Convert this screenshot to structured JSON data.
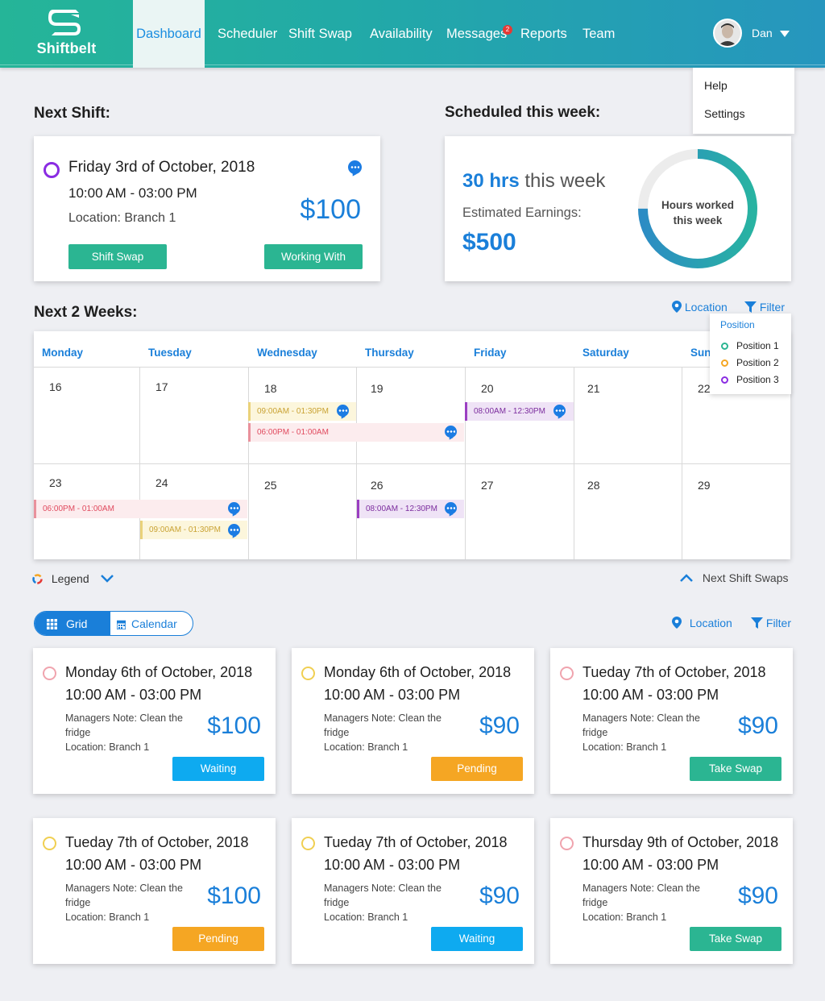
{
  "brand": {
    "name": "Shiftbelt"
  },
  "nav": {
    "items": [
      {
        "label": "Dashboard",
        "active": true
      },
      {
        "label": "Scheduler"
      },
      {
        "label": "Shift Swap"
      },
      {
        "label": "Availability"
      },
      {
        "label": "Messages",
        "badge": "2"
      },
      {
        "label": "Reports"
      },
      {
        "label": "Team"
      }
    ],
    "user": {
      "name": "Dan"
    },
    "user_menu": [
      "Help",
      "Settings"
    ]
  },
  "next_shift": {
    "title": "Next Shift:",
    "date": "Friday 3rd of October, 2018",
    "time": "10:00 AM - 03:00 PM",
    "location": "Location: Branch 1",
    "price": "$100",
    "buttons": {
      "swap": "Shift Swap",
      "working_with": "Working With"
    }
  },
  "scheduled": {
    "title": "Scheduled this week:",
    "hours": "30 hrs",
    "hours_suffix": "this week",
    "earnings_label": "Estimated Earnings:",
    "earnings": "$500",
    "donut_label_line1": "Hours worked",
    "donut_label_line2": "this week",
    "donut_fraction": 0.75
  },
  "calendar": {
    "title": "Next 2 Weeks:",
    "location_label": "Location",
    "filter_label": "Filter",
    "days": [
      "Monday",
      "Tuesday",
      "Wednesday",
      "Thursday",
      "Friday",
      "Saturday",
      "Sunday"
    ],
    "week1_dates": [
      "16",
      "17",
      "18",
      "19",
      "20",
      "21",
      "22"
    ],
    "week2_dates": [
      "23",
      "24",
      "25",
      "26",
      "27",
      "28",
      "29"
    ],
    "events": {
      "e1": "09:00AM - 01:30PM",
      "e2": "06:00PM - 01:00AM",
      "e3": "08:00AM - 12:30PM",
      "e4": "06:00PM - 01:00AM",
      "e5": "09:00AM - 01:30PM",
      "e6": "08:00AM - 12:30PM"
    },
    "filter_popup": {
      "heading": "Position",
      "positions": [
        "Position 1",
        "Position 2",
        "Position 3"
      ]
    },
    "legend_label": "Legend",
    "next_swaps_label": "Next Shift Swaps"
  },
  "swaps": {
    "toggle": {
      "grid": "Grid",
      "calendar": "Calendar"
    },
    "location_label": "Location",
    "filter_label": "Filter",
    "cards": [
      {
        "date": "Monday 6th of October, 2018",
        "time": "10:00 AM - 03:00 PM",
        "note": "Managers Note: Clean the fridge",
        "location": "Location: Branch 1",
        "price": "$100",
        "status": "Waiting"
      },
      {
        "date": "Monday 6th of October, 2018",
        "time": "10:00 AM - 03:00 PM",
        "note": "Managers Note: Clean the fridge",
        "location": "Location: Branch 1",
        "price": "$90",
        "status": "Pending"
      },
      {
        "date": "Tueday 7th of October, 2018",
        "time": "10:00 AM - 03:00 PM",
        "note": "Managers Note: Clean the fridge",
        "location": "Location: Branch 1",
        "price": "$90",
        "status": "Take Swap"
      },
      {
        "date": "Tueday 7th of October, 2018",
        "time": "10:00 AM - 03:00 PM",
        "note": "Managers Note: Clean the fridge",
        "location": "Location: Branch 1",
        "price": "$100",
        "status": "Pending"
      },
      {
        "date": "Tueday 7th of October, 2018",
        "time": "10:00 AM - 03:00 PM",
        "note": "Managers Note: Clean the fridge",
        "location": "Location: Branch 1",
        "price": "$90",
        "status": "Waiting"
      },
      {
        "date": "Thursday 9th of October, 2018",
        "time": "10:00 AM - 03:00 PM",
        "note": "Managers Note: Clean the fridge",
        "location": "Location: Branch 1",
        "price": "$90",
        "status": "Take Swap"
      }
    ]
  },
  "colors": {
    "accent_blue": "#1a7fd9",
    "green": "#2bb592",
    "orange": "#f5a623",
    "sky": "#0eaaf0",
    "position1": "#2bb592",
    "position2": "#f5a623",
    "position3": "#8a2be2"
  }
}
